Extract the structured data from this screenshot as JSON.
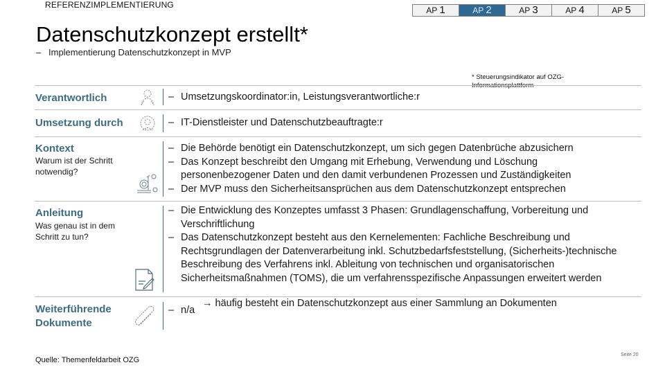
{
  "header": {
    "kicker": "REFERENZIMPLEMENTIERUNG",
    "title": "Datenschutzkonzept erstellt*",
    "subtitle": "Implementierung Datenschutzkonzept in MVP",
    "footnote": "* Steuerungsindikator auf OZG-Informationsplattform"
  },
  "tabs": [
    {
      "prefix": "AP",
      "num": "1",
      "active": false
    },
    {
      "prefix": "AP",
      "num": "2",
      "active": true
    },
    {
      "prefix": "AP",
      "num": "3",
      "active": false
    },
    {
      "prefix": "AP",
      "num": "4",
      "active": false
    },
    {
      "prefix": "AP",
      "num": "5",
      "active": false
    }
  ],
  "colors": {
    "accent": "#2f6891",
    "heading": "#3d6c82"
  },
  "rows": {
    "verantwortlich": {
      "label": "Verantwortlich",
      "icon": "people-icon",
      "items": [
        "Umsetzungskoordinator:in, Leistungsverantwortliche:r"
      ]
    },
    "umsetzung": {
      "label": "Umsetzung durch",
      "icon": "team-icon",
      "items": [
        "IT-Dienstleister und Datenschutzbeauftragte:r"
      ]
    },
    "kontext": {
      "label": "Kontext",
      "sublabel": "Warum ist der Schritt notwendig?",
      "icon": "molecule-icon",
      "items": [
        "Die Behörde benötigt ein Datenschutzkonzept, um sich gegen Datenbrüche abzusichern",
        "Das Konzept beschreibt den Umgang mit Erhebung, Verwendung und Löschung personenbezogener Daten und den damit verbundenen Prozessen und Zuständigkeiten",
        "Der MVP muss den Sicherheitsansprüchen aus dem Datenschutzkonzept entsprechen"
      ]
    },
    "anleitung": {
      "label": "Anleitung",
      "sublabel": "Was genau ist in dem Schritt zu tun?",
      "icon": "document-edit-icon",
      "items": [
        "Die Entwicklung des Konzeptes umfasst 3 Phasen: Grundlagenschaffung, Vorbereitung und Verschriftlichung",
        "Das Datenschutzkonzept besteht aus den Kernelementen: Fachliche Beschreibung und Rechtsgrundlagen der Datenverarbeitung inkl. Schutzbedarfsfeststellung, (Sicherheits-)technische Beschreibung des Verfahrens inkl. Ableitung von technischen und organisatorischen Sicherheitsmaßnahmen (TOMS), die um verfahrensspezifische Anpassungen erweitert werden"
      ],
      "note": "→ häufig besteht ein Datenschutzkonzept aus einer Sammlung an Dokumenten"
    },
    "dokumente": {
      "label": "Weiterführende Dokumente",
      "icon": "paperclip-icon",
      "items": [
        "n/a"
      ]
    }
  },
  "footer": {
    "source": "Quelle: Themenfeldarbeit OZG",
    "page": "Seite 20"
  }
}
